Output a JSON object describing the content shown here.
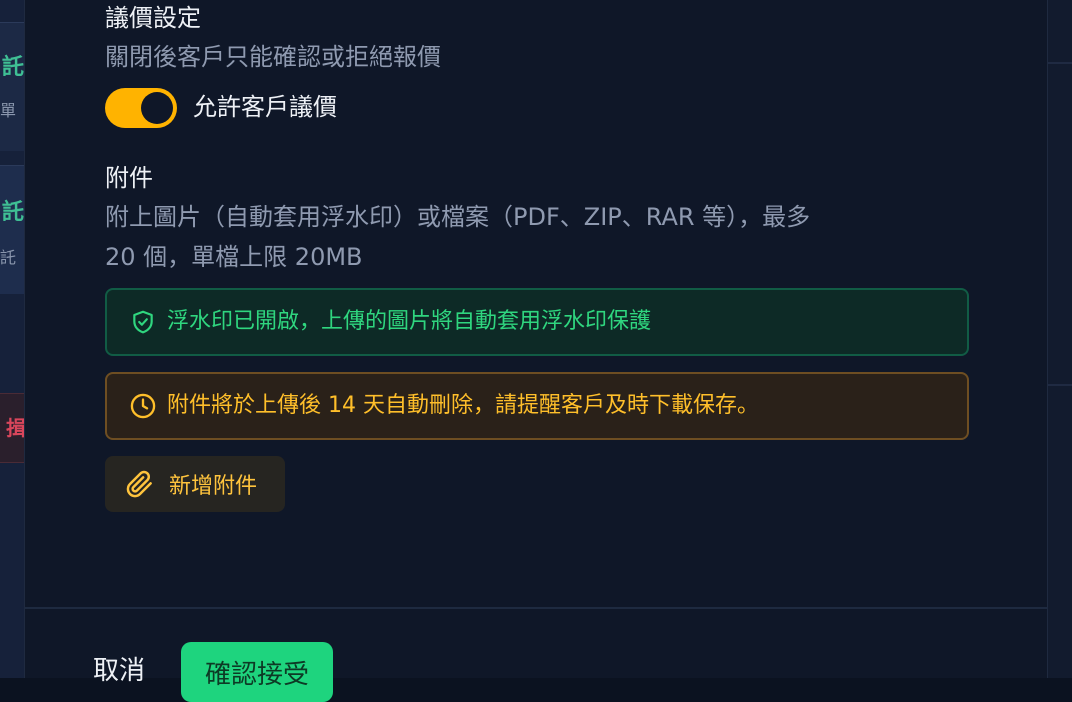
{
  "background": {
    "card1_title": "託",
    "card1_sub": "單",
    "card2_title": "託",
    "card2_sub": "託",
    "card3_title": "揖"
  },
  "negotiation": {
    "title": "議價設定",
    "description": "關閉後客戶只能確認或拒絕報價",
    "toggle_label": "允許客戶議價",
    "toggle_on": true
  },
  "attachments": {
    "title": "附件",
    "description_line1": "附上圖片（自動套用浮水印）或檔案（PDF、ZIP、RAR 等），最多",
    "description_line2": "20 個，單檔上限 20MB",
    "watermark_notice": "浮水印已開啟，上傳的圖片將自動套用浮水印保護",
    "expiry_notice": "附件將於上傳後 14 天自動刪除，請提醒客戶及時下載保存。",
    "add_button": "新增附件"
  },
  "footer": {
    "cancel": "取消",
    "confirm": "確認接受"
  },
  "colors": {
    "accent": "#ffb300",
    "success": "#2fd67f",
    "warning": "#ffbf2a",
    "confirm_bg": "#1ed47e"
  },
  "icons": {
    "watermark": "shield-check-icon",
    "expiry": "clock-icon",
    "attach": "paperclip-icon"
  }
}
